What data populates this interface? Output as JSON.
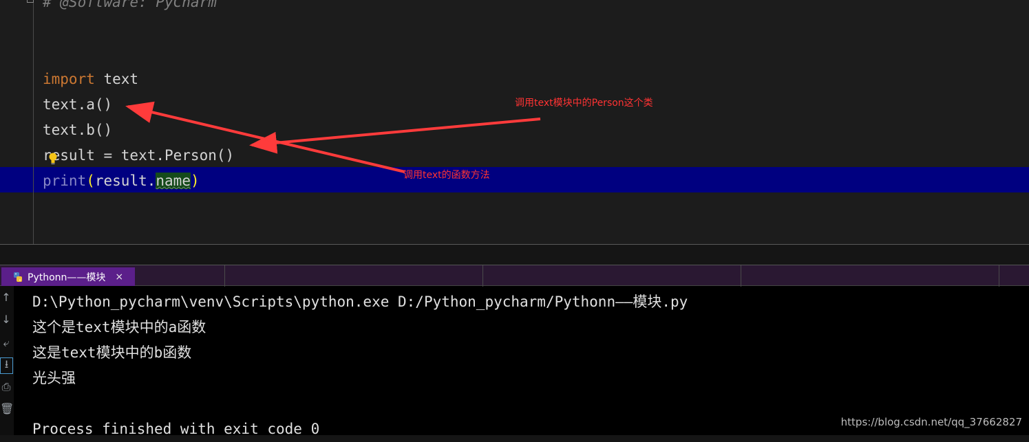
{
  "editor": {
    "comment_line": "# @Software: PyCharm",
    "import_kw": "import",
    "import_module": " text",
    "line_call_a": "text.a()",
    "line_call_b": "text.b()",
    "line_result": "result = text.Person()",
    "print_kw": "print",
    "print_open": "(",
    "print_arg": "result.",
    "print_attr": "name",
    "print_close": ")"
  },
  "annotations": {
    "person_note": "调用text模块中的Person这个类",
    "function_note": "调用text的函数方法"
  },
  "run_panel": {
    "tab_label": "Pythonn——模块",
    "tab_close": "×",
    "console_lines": [
      "D:\\Python_pycharm\\venv\\Scripts\\python.exe D:/Python_pycharm/Pythonn——模块.py",
      "这个是text模块中的a函数",
      "这是text模块中的b函数",
      "光头强",
      "",
      "Process finished with exit code 0"
    ]
  },
  "watermark": "https://blog.csdn.net/qq_37662827",
  "colors": {
    "keyword": "#cc7832",
    "builtin": "#8888c6",
    "annotation": "#ff3333",
    "current_line": "#000080",
    "run_tab": "#5b1f8a"
  }
}
